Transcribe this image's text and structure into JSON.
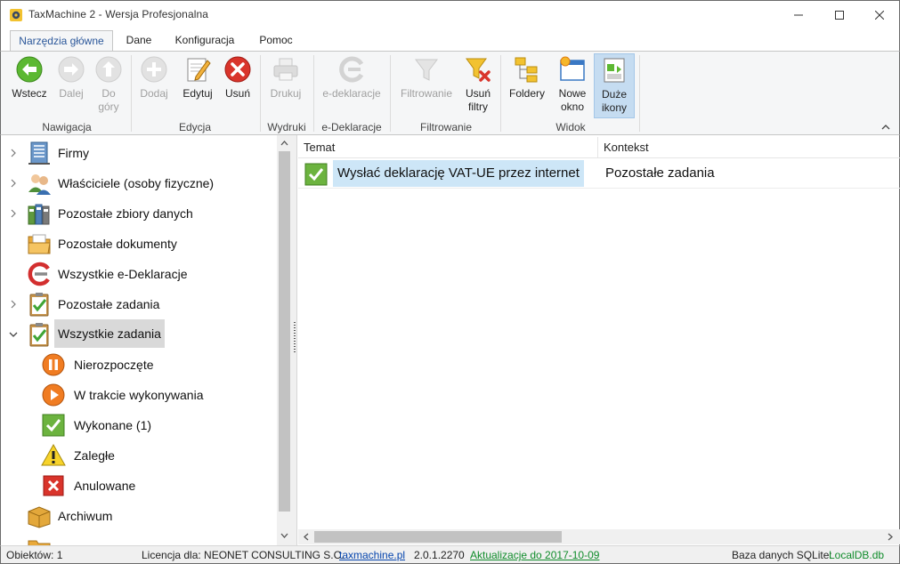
{
  "window": {
    "title": "TaxMachine 2  -  Wersja Profesjonalna",
    "minimize_icon": "minimize-icon",
    "maximize_icon": "maximize-icon",
    "close_icon": "close-icon"
  },
  "ribbon_tabs": [
    {
      "label": "Narzędzia główne",
      "active": true
    },
    {
      "label": "Dane",
      "active": false
    },
    {
      "label": "Konfiguracja",
      "active": false
    },
    {
      "label": "Pomoc",
      "active": false
    }
  ],
  "ribbon": {
    "groups": {
      "nawigacja": "Nawigacja",
      "edycja": "Edycja",
      "wydruki": "Wydruki",
      "edeklaracje": "e-Deklaracje",
      "filtrowanie": "Filtrowanie",
      "widok": "Widok"
    },
    "buttons": {
      "wstecz": "Wstecz",
      "dalej": "Dalej",
      "do_gory_1": "Do",
      "do_gory_2": "góry",
      "dodaj": "Dodaj",
      "edytuj": "Edytuj",
      "usun": "Usuń",
      "drukuj": "Drukuj",
      "edeklaracje": "e-deklaracje",
      "filtrowanie": "Filtrowanie",
      "usun_filtry_1": "Usuń",
      "usun_filtry_2": "filtry",
      "foldery": "Foldery",
      "nowe_okno_1": "Nowe",
      "nowe_okno_2": "okno",
      "duze_ikony_1": "Duże",
      "duze_ikony_2": "ikony"
    }
  },
  "tree": {
    "items": [
      {
        "label": "Firmy",
        "icon": "building-icon"
      },
      {
        "label": "Właściciele (osoby fizyczne)",
        "icon": "people-icon"
      },
      {
        "label": "Pozostałe zbiory danych",
        "icon": "binders-icon"
      },
      {
        "label": "Pozostałe dokumenty",
        "icon": "folder-documents-icon"
      },
      {
        "label": "Wszystkie e-Deklaracje",
        "icon": "edeclaration-icon"
      },
      {
        "label": "Pozostałe zadania",
        "icon": "clipboard-check-icon"
      },
      {
        "label": "Wszystkie zadania",
        "icon": "clipboard-check-icon",
        "selected": true
      },
      {
        "label": "Nierozpoczęte",
        "icon": "pause-icon"
      },
      {
        "label": "W trakcie wykonywania",
        "icon": "play-icon"
      },
      {
        "label": "Wykonane (1)",
        "icon": "check-icon"
      },
      {
        "label": "Zaległe",
        "icon": "warning-icon"
      },
      {
        "label": "Anulowane",
        "icon": "cancel-icon"
      },
      {
        "label": "Archiwum",
        "icon": "archive-box-icon"
      }
    ]
  },
  "grid": {
    "columns": [
      "Temat",
      "Kontekst"
    ],
    "rows": [
      {
        "temat": "Wysłać deklarację VAT-UE przez internet",
        "kontekst": "Pozostałe zadania",
        "icon": "check-icon"
      }
    ]
  },
  "status": {
    "objects": "Obiektów: 1",
    "license": "Licencja dla: NEONET CONSULTING S.C.",
    "site": "taxmachine.pl",
    "version": "2.0.1.2270",
    "update": "Aktualizacje do 2017-10-09",
    "db_label": "Baza danych SQLite:",
    "db_file": "LocalDB.db"
  },
  "colors": {
    "accent": "#2b579a",
    "selection": "#cde6f7",
    "status_green": "#108c2b"
  }
}
